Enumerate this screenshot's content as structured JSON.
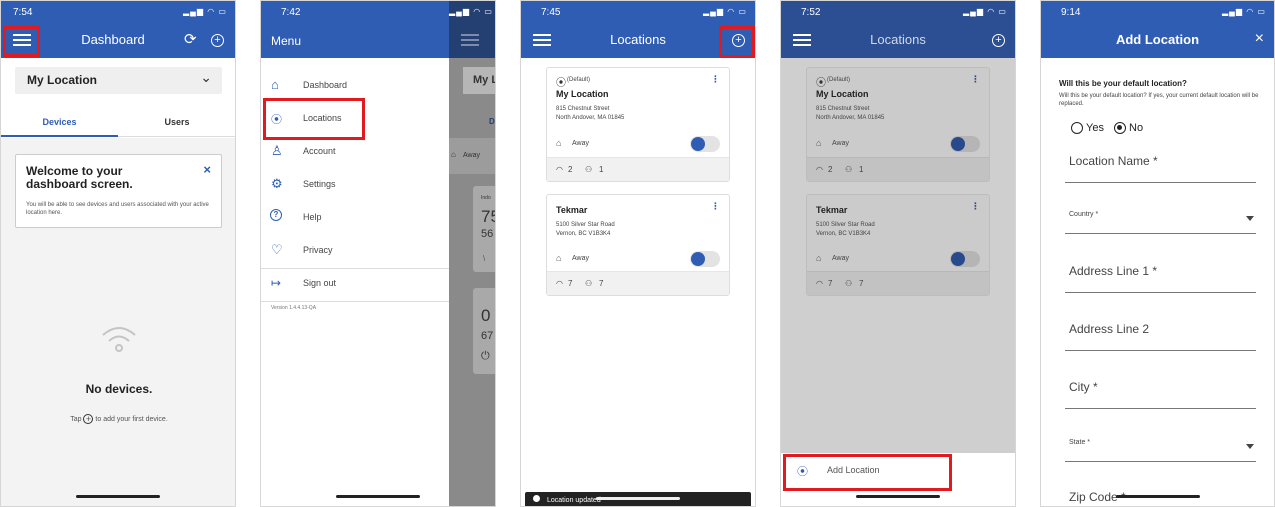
{
  "screen1": {
    "time": "7:54",
    "status_icons": "▂▄▆ ◠ ▭",
    "title": "Dashboard",
    "refresh_glyph": "⟳",
    "add_glyph": "+",
    "location_select": "My Location",
    "chevron_glyph": "⌄",
    "tabs": [
      "Devices",
      "Users"
    ],
    "welcome_title": "Welcome to your dashboard screen.",
    "welcome_close": "×",
    "welcome_body": "You will be able to see devices and users associated with your active location here.",
    "empty_title": "No devices.",
    "empty_hint_before": "Tap",
    "empty_hint_after": "to add your first device."
  },
  "screen2": {
    "time": "7:42",
    "menu_title": "Menu",
    "menu_items": [
      {
        "icon": "⌂",
        "label": "Dashboard"
      },
      {
        "icon": "⦿",
        "label": "Locations"
      },
      {
        "icon": "♙",
        "label": "Account"
      },
      {
        "icon": "⚙",
        "label": "Settings"
      },
      {
        "icon": "?",
        "label": "Help"
      },
      {
        "icon": "♡",
        "label": "Privacy"
      }
    ],
    "sign_out_icon": "↦",
    "sign_out": "Sign out",
    "version": "Version 1.4.4.13-QA",
    "peek": [
      "My L",
      "D",
      "Away",
      "Indo",
      "75",
      "56",
      "\\",
      "0",
      "67",
      "⏻"
    ]
  },
  "locations": [
    {
      "default_label": "(Default)",
      "name": "My Location",
      "address1": "815 Chestnut Street",
      "address2": "North Andover, MA 01845",
      "mode": "Away",
      "devices": "2",
      "users": "1"
    },
    {
      "default_label": "",
      "name": "Tekmar",
      "address1": "5100 Silver Star Road",
      "address2": "Vernon, BC V1B3K4",
      "mode": "Away",
      "devices": "7",
      "users": "7"
    }
  ],
  "screen3": {
    "time": "7:45",
    "title": "Locations",
    "toast": "Location updated"
  },
  "screen4": {
    "time": "7:52",
    "title": "Locations",
    "sheet_item": "Add Location"
  },
  "screen5": {
    "time": "9:14",
    "title": "Add Location",
    "close_glyph": "×",
    "question": "Will this be your default location?",
    "question_help": "Will this be your default location? If yes, your current default location will be replaced.",
    "radio_yes": "Yes",
    "radio_no": "No",
    "fields": [
      {
        "label": "Location Name *",
        "dropdown": false
      },
      {
        "label": "Country *",
        "dropdown": true
      },
      {
        "label": "Address Line 1 *",
        "dropdown": false
      },
      {
        "label": "Address Line 2",
        "dropdown": false
      },
      {
        "label": "City *",
        "dropdown": false
      },
      {
        "label": "State *",
        "dropdown": true
      },
      {
        "label": "Zip Code *",
        "dropdown": false
      }
    ]
  },
  "colors": {
    "primary": "#2f5db3",
    "highlight": "#e11a1f"
  },
  "icons": [
    "hamburger-menu-icon",
    "refresh-icon",
    "add-circle-icon",
    "chevron-down-icon",
    "close-icon",
    "wifi-icon",
    "location-pin-icon",
    "away-mode-icon",
    "users-icon",
    "kebab-menu-icon"
  ]
}
